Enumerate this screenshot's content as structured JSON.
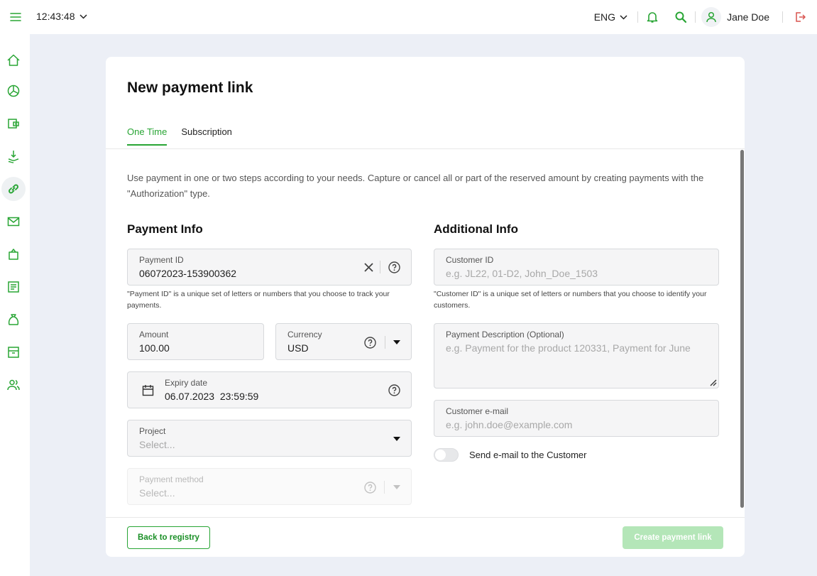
{
  "topbar": {
    "time": "12:43:48",
    "language": "ENG",
    "user_name": "Jane Doe"
  },
  "sidebar": {
    "items": [
      {
        "name": "home-icon"
      },
      {
        "name": "analytics-icon"
      },
      {
        "name": "wallet-icon"
      },
      {
        "name": "payouts-icon"
      },
      {
        "name": "payment-links-icon",
        "active": true
      },
      {
        "name": "mail-icon"
      },
      {
        "name": "shopping-bag-icon"
      },
      {
        "name": "reports-icon"
      },
      {
        "name": "money-bag-icon"
      },
      {
        "name": "archive-icon"
      },
      {
        "name": "users-icon"
      }
    ]
  },
  "page": {
    "title": "New payment link",
    "tabs": [
      {
        "label": "One Time",
        "active": true
      },
      {
        "label": "Subscription",
        "active": false
      }
    ],
    "description": "Use payment in one or two steps according to your needs. Capture or cancel all or part of the reserved amount by creating payments with the \"Authorization\" type."
  },
  "payment_info": {
    "heading": "Payment Info",
    "payment_id": {
      "label": "Payment ID",
      "value": "06072023-153900362",
      "hint": "\"Payment ID\" is a unique set of letters or numbers that you choose to track your payments."
    },
    "amount": {
      "label": "Amount",
      "value": "100.00"
    },
    "currency": {
      "label": "Currency",
      "value": "USD"
    },
    "expiry": {
      "label": "Expiry date",
      "value": "06.07.2023  23:59:59"
    },
    "project": {
      "label": "Project",
      "placeholder": "Select..."
    },
    "payment_method": {
      "label": "Payment method",
      "placeholder": "Select...",
      "disabled": true
    }
  },
  "additional_info": {
    "heading": "Additional Info",
    "customer_id": {
      "label": "Customer ID",
      "placeholder": "e.g. JL22, 01-D2, John_Doe_1503",
      "hint": "\"Customer ID\" is a unique set of letters or numbers that you choose to identify your customers."
    },
    "description": {
      "label": "Payment Description (Optional)",
      "placeholder": "e.g. Payment for the product 120331, Payment for June"
    },
    "email": {
      "label": "Customer e-mail",
      "placeholder": "e.g. john.doe@example.com"
    },
    "send_email": {
      "label": "Send e-mail to the Customer",
      "on": false
    }
  },
  "footer": {
    "back_label": "Back to registry",
    "create_label": "Create payment link"
  },
  "colors": {
    "accent": "#28a534",
    "disabled_button": "#b4e6b8",
    "logout": "#d9534f",
    "background": "#eceff6"
  }
}
